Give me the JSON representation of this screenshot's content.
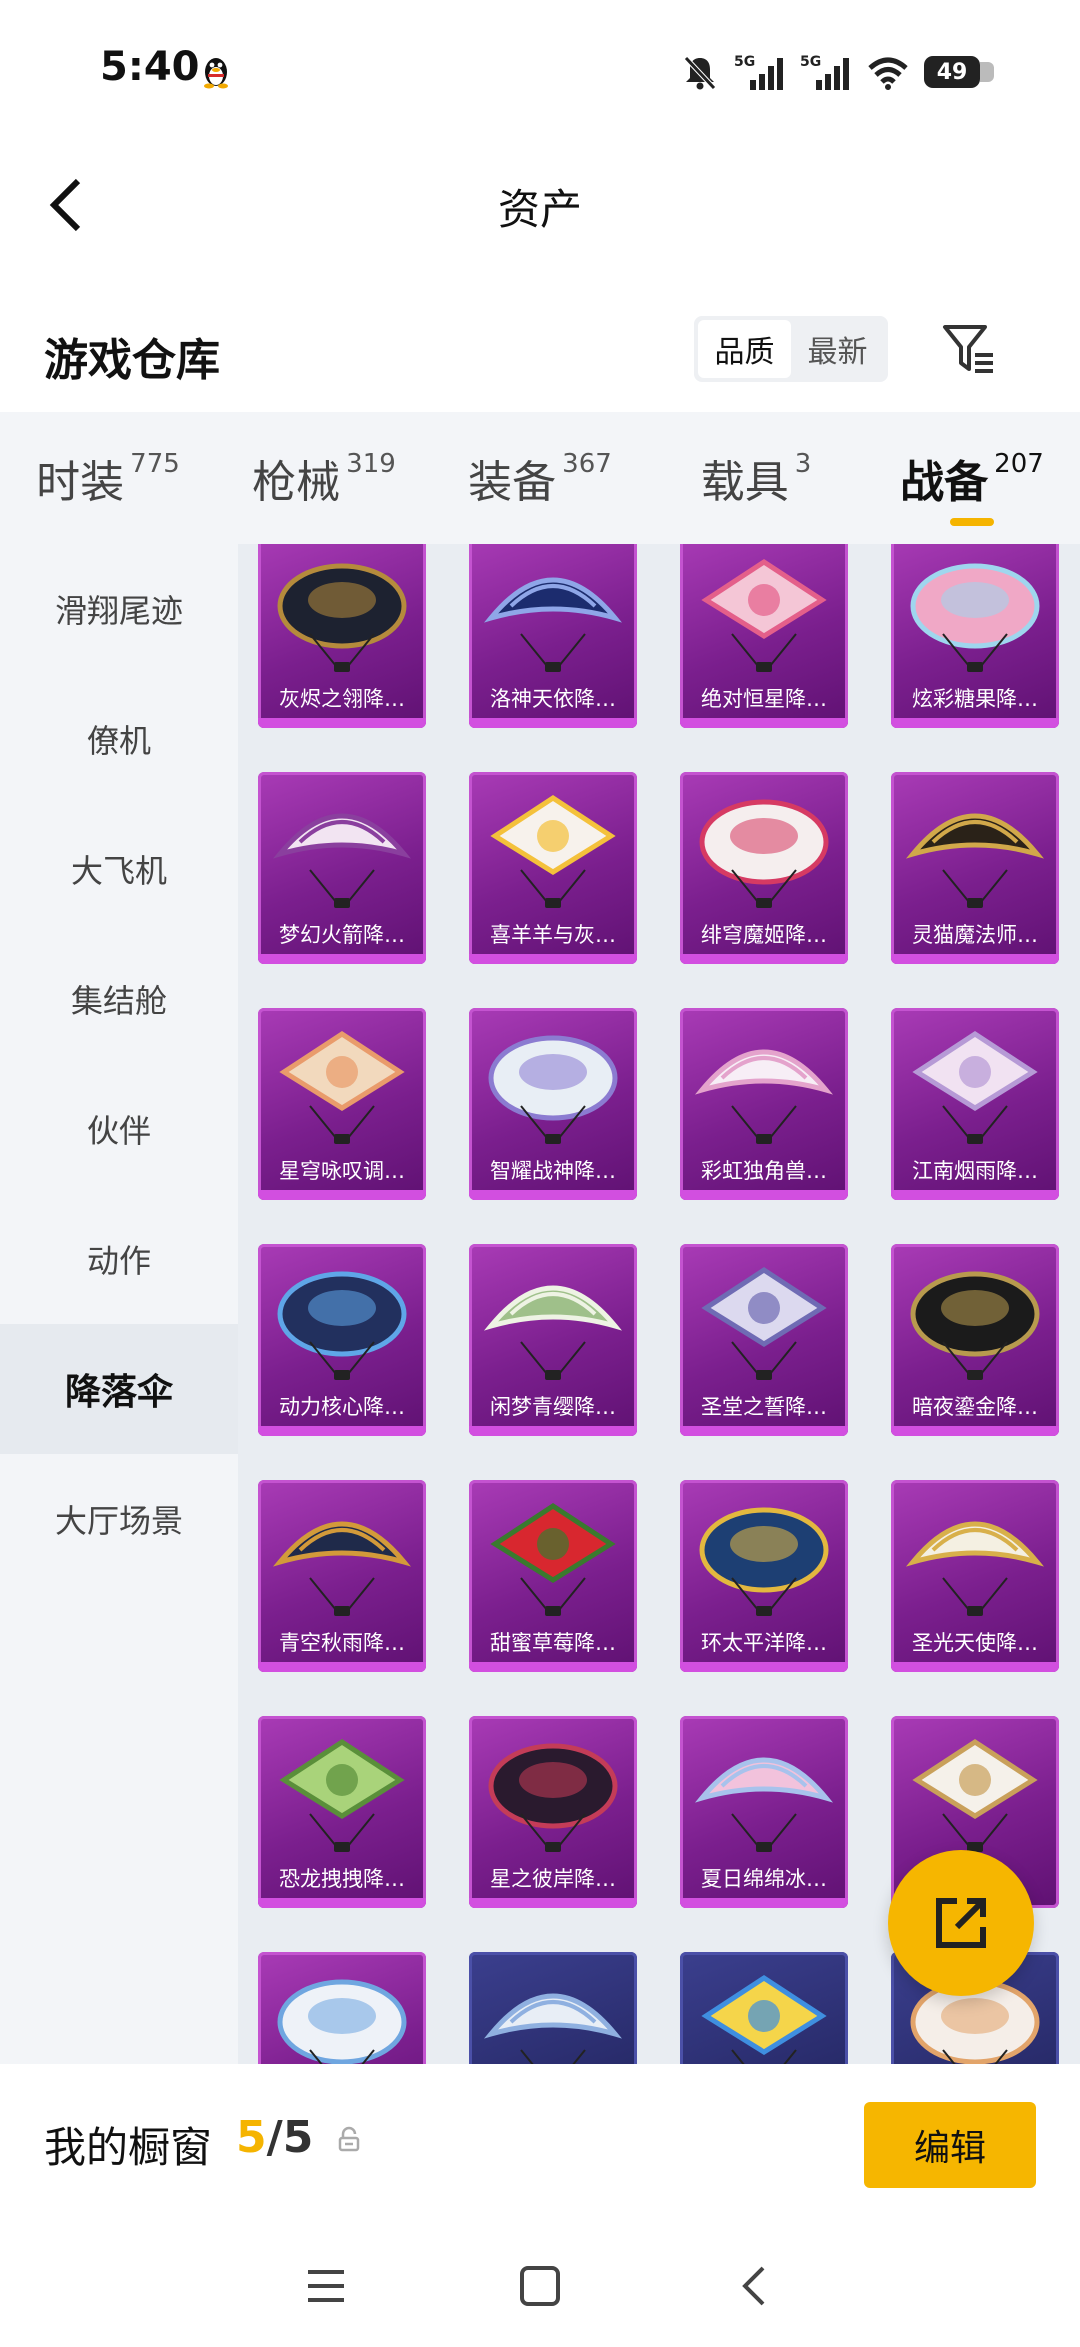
{
  "status_bar": {
    "time": "5:40",
    "battery": "49"
  },
  "header": {
    "title": "资产"
  },
  "warehouse": {
    "title": "游戏仓库",
    "sort_options": [
      "品质",
      "最新"
    ]
  },
  "category_tabs": [
    {
      "label": "时装",
      "count": "775"
    },
    {
      "label": "枪械",
      "count": "319"
    },
    {
      "label": "装备",
      "count": "367"
    },
    {
      "label": "载具",
      "count": "3"
    },
    {
      "label": "战备",
      "count": "207",
      "active": true
    }
  ],
  "sidebar": {
    "items": [
      "滑翔尾迹",
      "僚机",
      "大飞机",
      "集结舱",
      "伙伴",
      "动作",
      "降落伞",
      "大厅场景"
    ],
    "active": "降落伞"
  },
  "items": [
    {
      "name": "灰烬之翎降…",
      "colors": [
        "#1d2230",
        "#b58b3c"
      ]
    },
    {
      "name": "洛神天依降…",
      "colors": [
        "#1c2c6e",
        "#8fa6e8"
      ]
    },
    {
      "name": "绝对恒星降…",
      "colors": [
        "#f4c6d6",
        "#e45f8a"
      ]
    },
    {
      "name": "炫彩糖果降…",
      "colors": [
        "#f0a8c6",
        "#9fd6ee"
      ]
    },
    {
      "name": "梦幻火箭降…",
      "colors": [
        "#f2e4f2",
        "#8a3f9e"
      ]
    },
    {
      "name": "喜羊羊与灰…",
      "colors": [
        "#f7f2ec",
        "#f4c13b"
      ]
    },
    {
      "name": "绯穹魔姬降…",
      "colors": [
        "#f5eeee",
        "#d63a63"
      ]
    },
    {
      "name": "灵猫魔法师…",
      "colors": [
        "#2a2218",
        "#d1a84a"
      ]
    },
    {
      "name": "星穹咏叹调…",
      "colors": [
        "#f2d9bd",
        "#e99b6b"
      ]
    },
    {
      "name": "智耀战神降…",
      "colors": [
        "#e8eef5",
        "#8b7bd1"
      ]
    },
    {
      "name": "彩虹独角兽…",
      "colors": [
        "#f7eef6",
        "#e4a3cc"
      ]
    },
    {
      "name": "江南烟雨降…",
      "colors": [
        "#f1e2f2",
        "#b69ad6"
      ]
    },
    {
      "name": "动力核心降…",
      "colors": [
        "#22305e",
        "#5fa6e8"
      ]
    },
    {
      "name": "闲梦青缨降…",
      "colors": [
        "#9fc08a",
        "#eef3e4"
      ]
    },
    {
      "name": "圣堂之誓降…",
      "colors": [
        "#dcd9ef",
        "#6f6bb4"
      ]
    },
    {
      "name": "暗夜鎏金降…",
      "colors": [
        "#1b1b1b",
        "#b89a4e"
      ]
    },
    {
      "name": "青空秋雨降…",
      "colors": [
        "#1f2a4a",
        "#d39a3a"
      ]
    },
    {
      "name": "甜蜜草莓降…",
      "colors": [
        "#d8272f",
        "#3a7a2e"
      ]
    },
    {
      "name": "环太平洋降…",
      "colors": [
        "#1d3f73",
        "#e3b83f"
      ]
    },
    {
      "name": "圣光天使降…",
      "colors": [
        "#f4f0e2",
        "#d8b04a"
      ]
    },
    {
      "name": "恐龙拽拽降…",
      "colors": [
        "#a9d37a",
        "#5a8f3a"
      ]
    },
    {
      "name": "星之彼岸降…",
      "colors": [
        "#2a1a2e",
        "#c43c58"
      ]
    },
    {
      "name": "夏日绵绵冰…",
      "colors": [
        "#f2c2dc",
        "#a8c2ec"
      ]
    },
    {
      "name": "",
      "colors": [
        "#f5f1ea",
        "#c9a05a"
      ]
    },
    {
      "name": "",
      "colors": [
        "#eef2f8",
        "#6fa6e0"
      ]
    },
    {
      "name": "",
      "colors": [
        "#e8eef6",
        "#8fb0e0"
      ]
    },
    {
      "name": "",
      "colors": [
        "#f5d54a",
        "#3f8fe0"
      ]
    },
    {
      "name": "",
      "colors": [
        "#f5eee8",
        "#e2a46a"
      ]
    }
  ],
  "showcase": {
    "title": "我的橱窗",
    "count_current": "5",
    "count_total": "/5",
    "edit_label": "编辑"
  }
}
